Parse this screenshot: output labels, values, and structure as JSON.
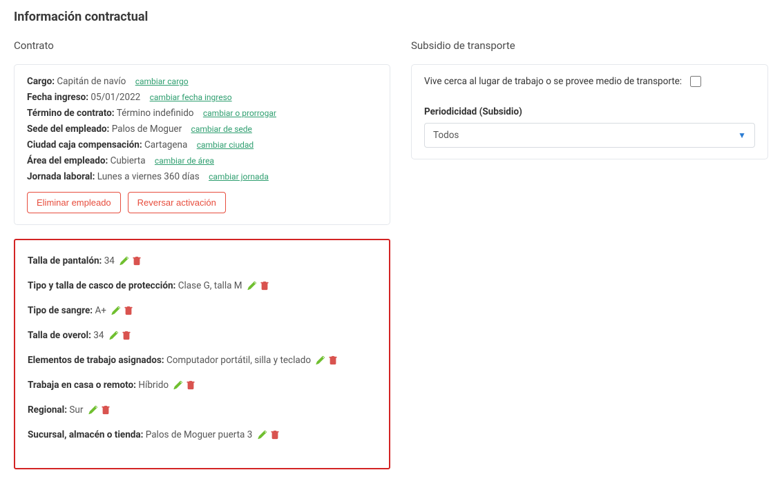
{
  "page_title": "Información contractual",
  "left": {
    "section_title": "Contrato",
    "contract": {
      "cargo_label": "Cargo:",
      "cargo_value": "Capitán de navío",
      "cargo_link": "cambiar cargo",
      "fecha_label": "Fecha ingreso:",
      "fecha_value": "05/01/2022",
      "fecha_link": "cambiar fecha ingreso",
      "termino_label": "Término de contrato:",
      "termino_value": "Término indefinido",
      "termino_link": "cambiar o prorrogar",
      "sede_label": "Sede del empleado:",
      "sede_value": "Palos de Moguer",
      "sede_link": "cambiar de sede",
      "ciudad_label": "Ciudad caja compensación:",
      "ciudad_value": "Cartagena",
      "ciudad_link": "cambiar ciudad",
      "area_label": "Área del empleado:",
      "area_value": "Cubierta",
      "area_link": "cambiar de área",
      "jornada_label": "Jornada laboral:",
      "jornada_value": "Lunes a viernes 360 días",
      "jornada_link": "cambiar jornada"
    },
    "buttons": {
      "delete": "Eliminar empleado",
      "revert": "Reversar activación"
    },
    "custom_fields": [
      {
        "label": "Talla de pantalón:",
        "value": "34"
      },
      {
        "label": "Tipo y talla de casco de protección:",
        "value": "Clase G, talla M"
      },
      {
        "label": "Tipo de sangre:",
        "value": "A+"
      },
      {
        "label": "Talla de overol:",
        "value": "34"
      },
      {
        "label": "Elementos de trabajo asignados:",
        "value": "Computador portátil, silla y teclado"
      },
      {
        "label": "Trabaja en casa o remoto:",
        "value": "Híbrido"
      },
      {
        "label": "Regional:",
        "value": "Sur"
      },
      {
        "label": "Sucursal, almacén o tienda:",
        "value": "Palos de Moguer puerta 3"
      }
    ]
  },
  "right": {
    "section_title": "Subsidio de transporte",
    "check_label": "Vive cerca al lugar de trabajo o se provee medio de transporte:",
    "periodicity_label": "Periodicidad (Subsidio)",
    "periodicity_value": "Todos"
  },
  "colors": {
    "link_green": "#2e9e6f",
    "danger": "#e74c3c",
    "highlight_border": "#d32323",
    "edit_icon": "#6fbf2f",
    "delete_icon": "#d9534f",
    "chevron": "#2b7cd3"
  }
}
